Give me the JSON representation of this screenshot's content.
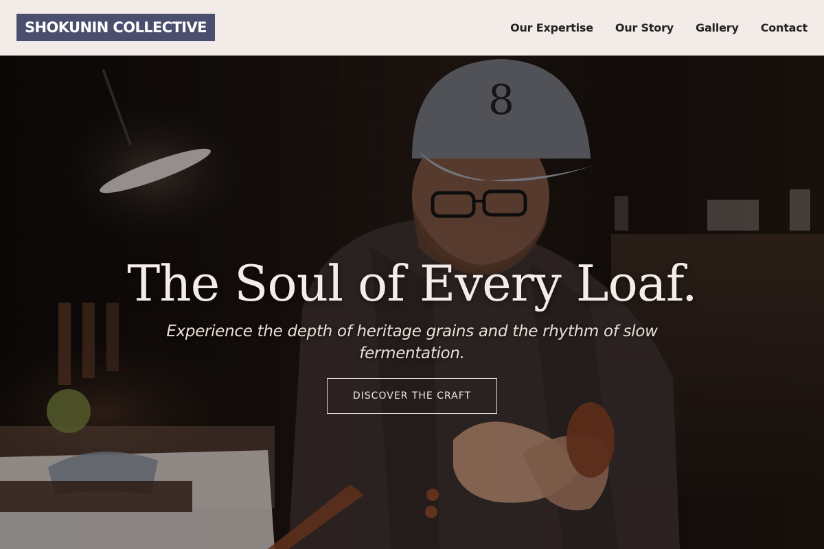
{
  "header": {
    "logo": "SHOKUNIN COLLECTIVE",
    "nav": [
      {
        "label": "Our Expertise"
      },
      {
        "label": "Our Story"
      },
      {
        "label": "Gallery"
      },
      {
        "label": "Contact"
      }
    ]
  },
  "hero": {
    "title": "The Soul of Every Loaf.",
    "subtitle": "Experience the depth of heritage grains and the rhythm of slow fermentation.",
    "cta": "DISCOVER THE CRAFT",
    "overlay_color": "#0c0806"
  },
  "colors": {
    "header_bg": "#f3ebe8",
    "logo_bg": "#4a4f6e",
    "nav_text": "#232323",
    "hero_text": "#f4ece8"
  }
}
